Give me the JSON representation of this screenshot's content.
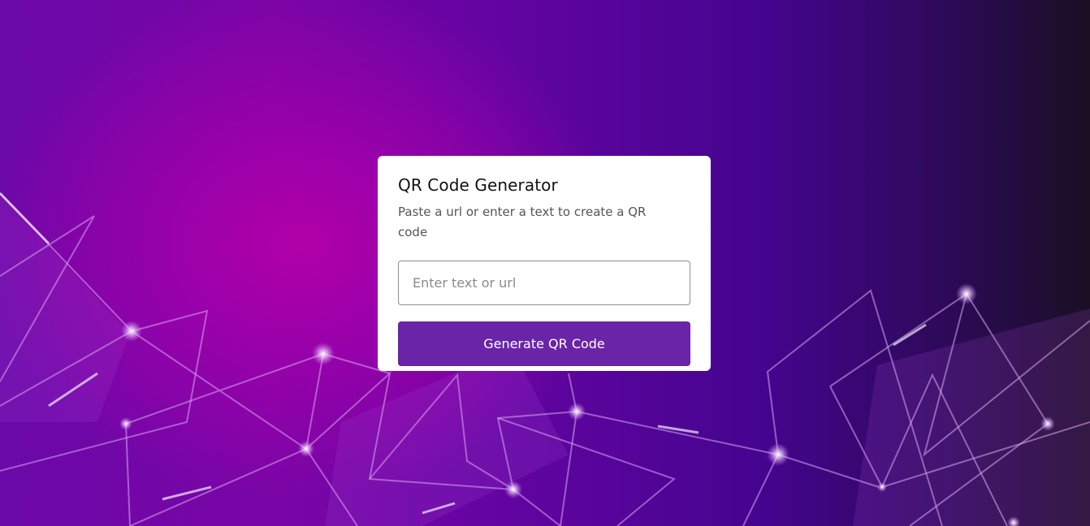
{
  "card": {
    "title": "QR Code Generator",
    "subtitle": "Paste a url or enter a text to create a QR code",
    "input": {
      "placeholder": "Enter text or url",
      "value": ""
    },
    "button_label": "Generate QR Code"
  },
  "colors": {
    "accent": "#6a24a8",
    "card_background": "#ffffff",
    "background_magenta": "#b100a8",
    "background_purple": "#45048f"
  }
}
